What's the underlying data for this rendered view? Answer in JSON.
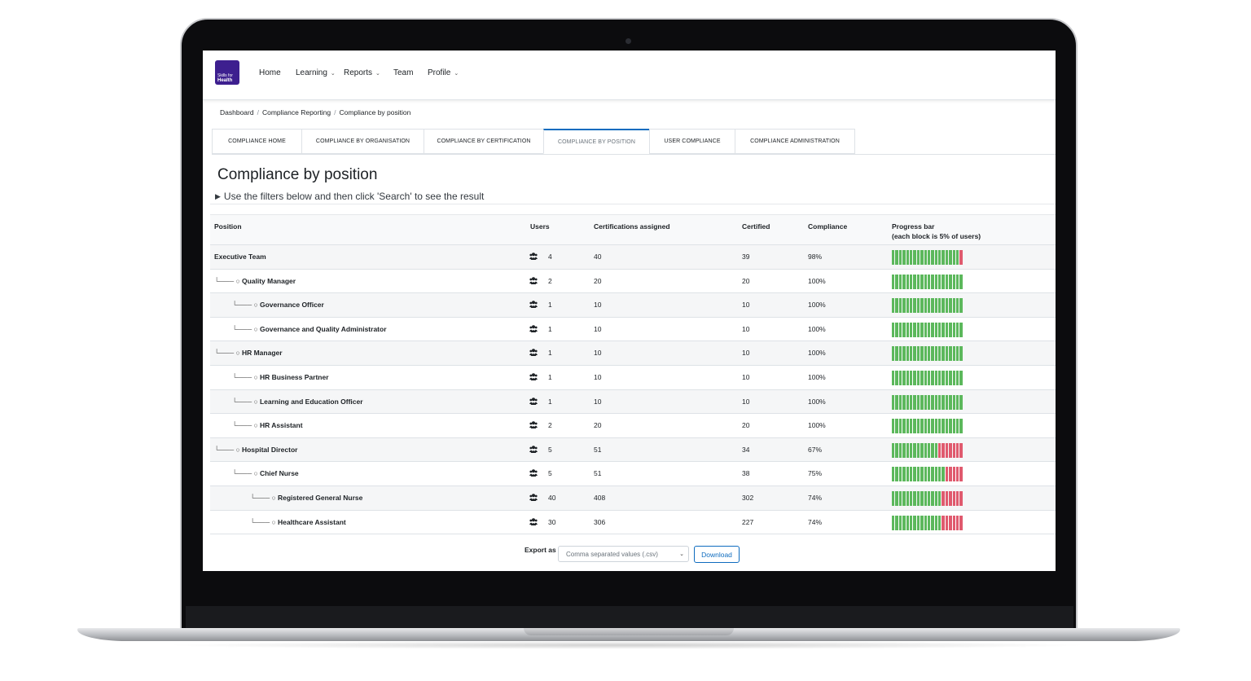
{
  "logo": {
    "text_top": "Skills for",
    "text_bottom": "Health"
  },
  "nav": {
    "home": "Home",
    "learning": "Learning",
    "reports": "Reports",
    "team": "Team",
    "profile": "Profile"
  },
  "breadcrumb": [
    "Dashboard",
    "Compliance Reporting",
    "Compliance by position"
  ],
  "tabs": [
    "COMPLIANCE HOME",
    "COMPLIANCE BY ORGANISATION",
    "COMPLIANCE BY CERTIFICATION",
    "COMPLIANCE BY POSITION",
    "USER COMPLIANCE",
    "COMPLIANCE ADMINISTRATION"
  ],
  "active_tab": "COMPLIANCE BY POSITION",
  "page_title": "Compliance by position",
  "filter_hint": "Use the filters below and then click 'Search' to see the result",
  "columns": {
    "position": "Position",
    "users": "Users",
    "certs": "Certifications assigned",
    "certified": "Certified",
    "compliance": "Compliance",
    "progress": "Progress bar",
    "progress_sub": "(each block is 5% of users)"
  },
  "rows": [
    {
      "position": "Executive Team",
      "level": 0,
      "users": "4",
      "certs": "40",
      "certified": "39",
      "compliance": "98%",
      "pct": 0.975
    },
    {
      "position": "Quality Manager",
      "level": 1,
      "users": "2",
      "certs": "20",
      "certified": "20",
      "compliance": "100%",
      "pct": 1.0
    },
    {
      "position": "Governance Officer",
      "level": 2,
      "users": "1",
      "certs": "10",
      "certified": "10",
      "compliance": "100%",
      "pct": 1.0
    },
    {
      "position": "Governance and Quality Administrator",
      "level": 2,
      "users": "1",
      "certs": "10",
      "certified": "10",
      "compliance": "100%",
      "pct": 1.0
    },
    {
      "position": "HR Manager",
      "level": 1,
      "users": "1",
      "certs": "10",
      "certified": "10",
      "compliance": "100%",
      "pct": 1.0
    },
    {
      "position": "HR Business Partner",
      "level": 2,
      "users": "1",
      "certs": "10",
      "certified": "10",
      "compliance": "100%",
      "pct": 1.0
    },
    {
      "position": "Learning and Education Officer",
      "level": 2,
      "users": "1",
      "certs": "10",
      "certified": "10",
      "compliance": "100%",
      "pct": 1.0
    },
    {
      "position": "HR Assistant",
      "level": 2,
      "users": "2",
      "certs": "20",
      "certified": "20",
      "compliance": "100%",
      "pct": 1.0
    },
    {
      "position": "Hospital Director",
      "level": 1,
      "users": "5",
      "certs": "51",
      "certified": "34",
      "compliance": "67%",
      "pct": 0.67
    },
    {
      "position": "Chief Nurse",
      "level": 2,
      "users": "5",
      "certs": "51",
      "certified": "38",
      "compliance": "75%",
      "pct": 0.75
    },
    {
      "position": "Registered General Nurse",
      "level": 3,
      "users": "40",
      "certs": "408",
      "certified": "302",
      "compliance": "74%",
      "pct": 0.74
    },
    {
      "position": "Healthcare Assistant",
      "level": 3,
      "users": "30",
      "certs": "306",
      "certified": "227",
      "compliance": "74%",
      "pct": 0.74
    }
  ],
  "export": {
    "label": "Export as",
    "selected": "Comma separated values (.csv)",
    "button": "Download"
  },
  "colors": {
    "green": "#5cb85c",
    "red": "#e05a6e",
    "brand": "#3d1f8f",
    "link": "#0f6cbf"
  }
}
